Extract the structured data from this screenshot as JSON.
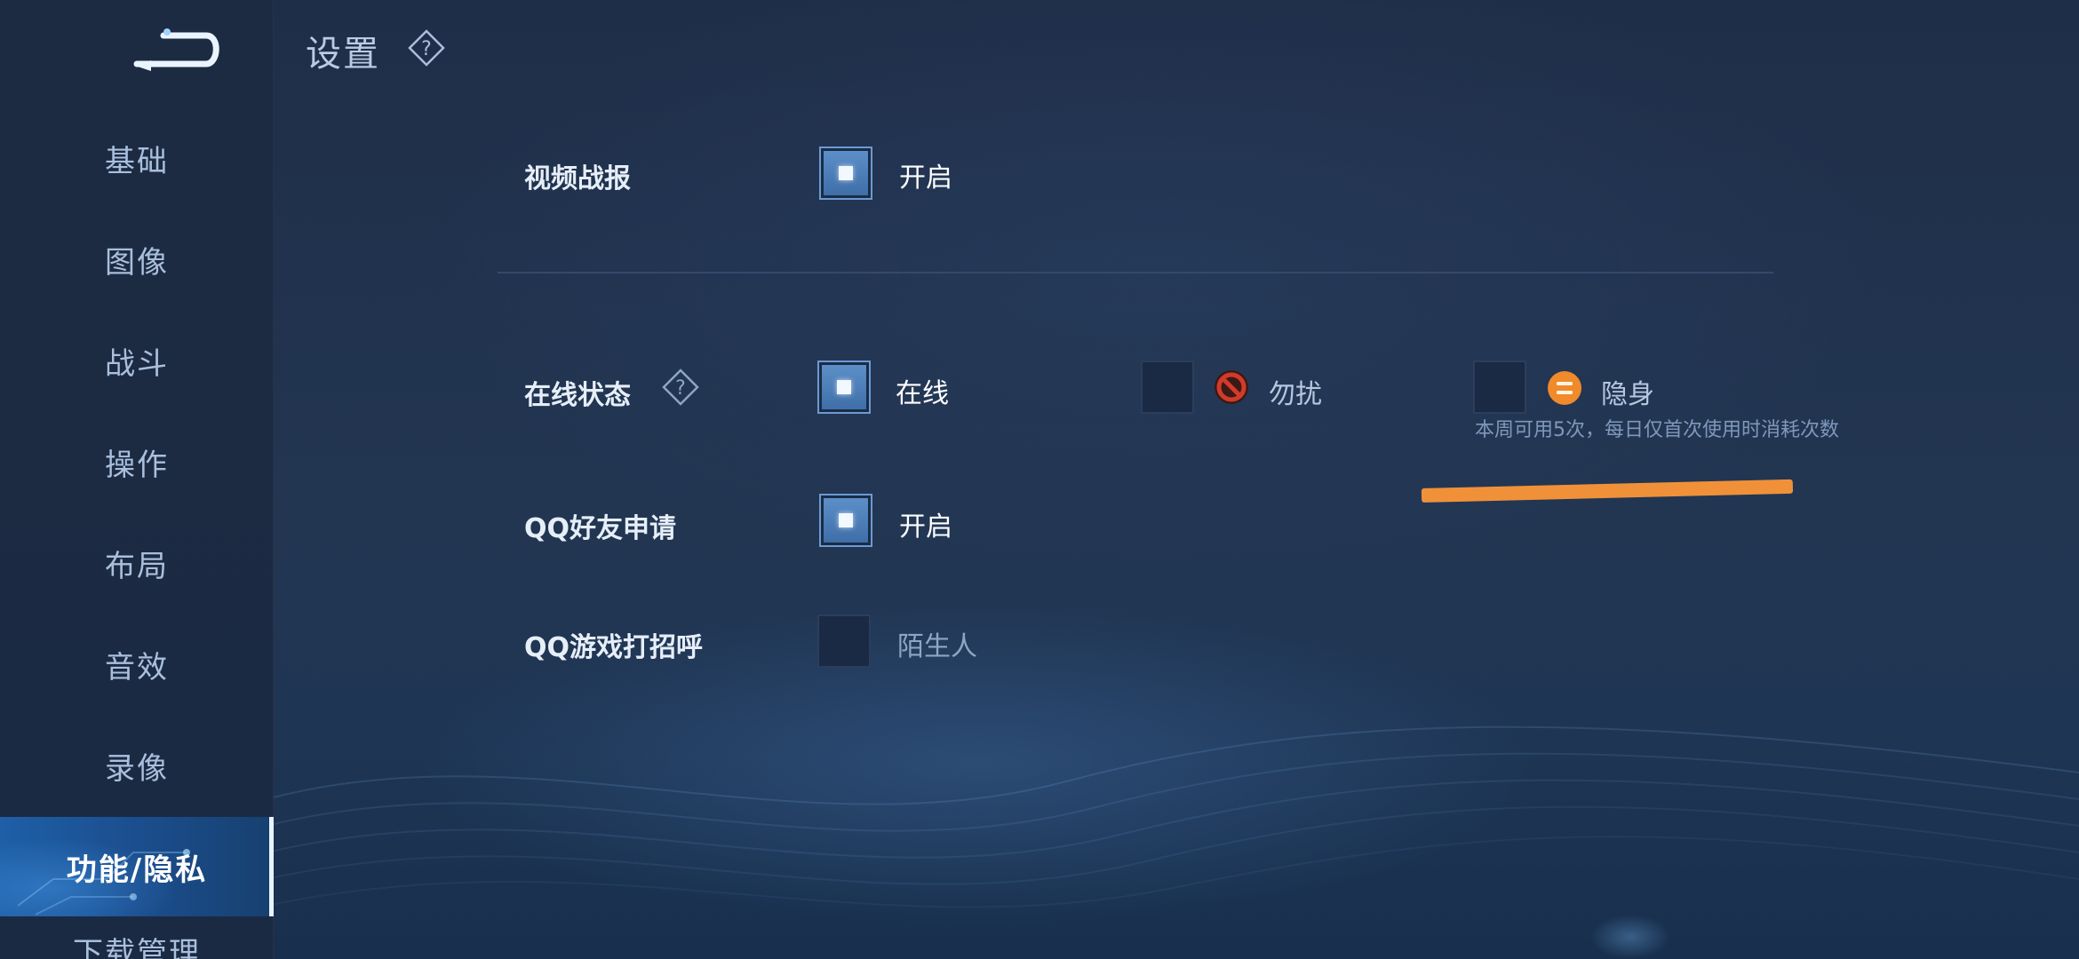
{
  "header": {
    "title": "设置"
  },
  "sidebar": {
    "items": [
      {
        "label": "基础"
      },
      {
        "label": "图像"
      },
      {
        "label": "战斗"
      },
      {
        "label": "操作"
      },
      {
        "label": "布局"
      },
      {
        "label": "音效"
      },
      {
        "label": "录像"
      },
      {
        "label": "功能/隐私",
        "active": true
      },
      {
        "label": "下载管理"
      }
    ]
  },
  "settings": {
    "video_report": {
      "label": "视频战报",
      "option": "开启",
      "checked": true
    },
    "online_status": {
      "label": "在线状态",
      "options": [
        {
          "label": "在线",
          "checked": true
        },
        {
          "label": "勿扰",
          "checked": false,
          "icon": "do-not-disturb-icon"
        },
        {
          "label": "隐身",
          "checked": false,
          "icon": "invisible-icon"
        }
      ],
      "hint": "本周可用5次，每日仅首次使用时消耗次数"
    },
    "qq_friend_request": {
      "label": "QQ好友申请",
      "option": "开启",
      "checked": true
    },
    "qq_game_greeting": {
      "label": "QQ游戏打招呼",
      "option": "陌生人",
      "checked": false
    }
  },
  "colors": {
    "accent": "#3f6ea8",
    "active_tab": "#1b4e8e",
    "annotation": "#f0913a",
    "dnd_red": "#d23a2a",
    "invisible_orange": "#f08a2a"
  }
}
